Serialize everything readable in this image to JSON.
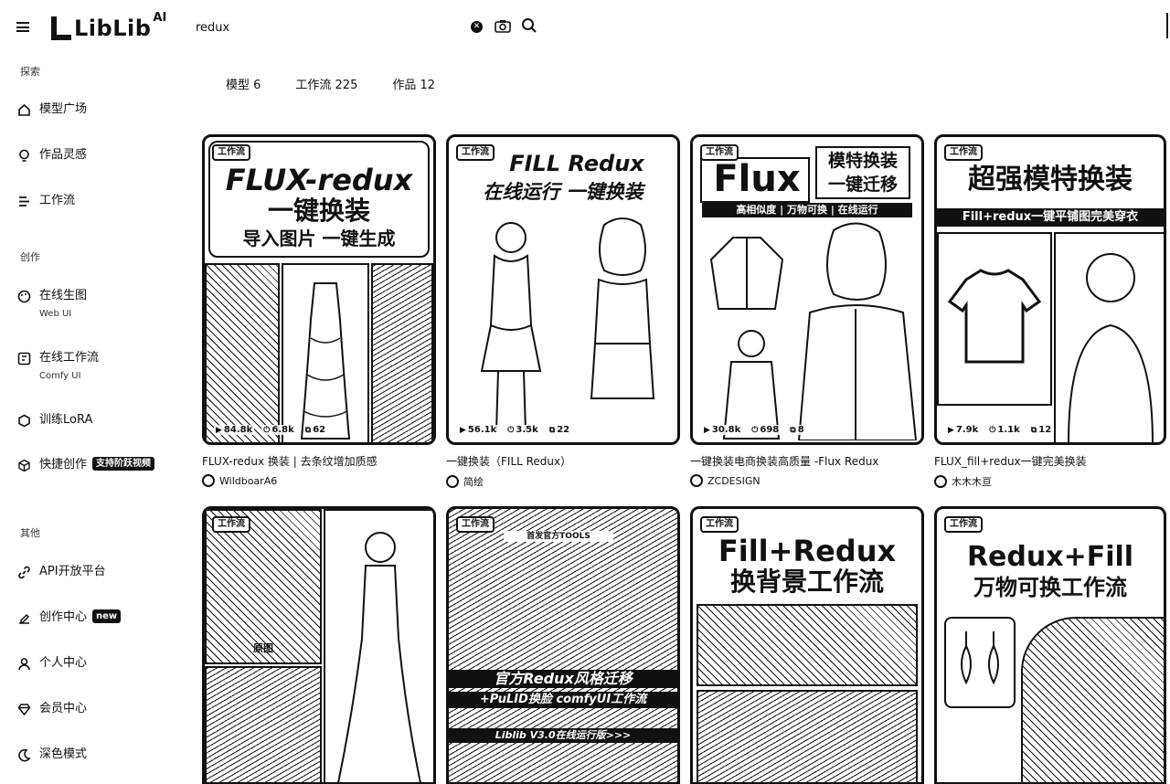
{
  "header": {
    "logo_text": "LibLib",
    "logo_ai": "AI",
    "search_value": "redux"
  },
  "sidebar": {
    "section_explore": "探索",
    "section_create": "创作",
    "section_other": "其他",
    "items": [
      {
        "label": "模型广场",
        "icon": "home-icon"
      },
      {
        "label": "作品灵感",
        "icon": "bulb-icon"
      },
      {
        "label": "工作流",
        "icon": "workflow-icon"
      },
      {
        "label": "在线生图",
        "sub": "Web UI",
        "icon": "palette-icon"
      },
      {
        "label": "在线工作流",
        "sub": "Comfy UI",
        "icon": "comfy-icon"
      },
      {
        "label": "训练LoRA",
        "icon": "cube-icon"
      },
      {
        "label": "快捷创作",
        "badge": "支持阶跃视频",
        "icon": "box-icon"
      },
      {
        "label": "API开放平台",
        "icon": "link-icon"
      },
      {
        "label": "创作中心",
        "badge": "new",
        "icon": "edit-icon"
      },
      {
        "label": "个人中心",
        "icon": "user-icon"
      },
      {
        "label": "会员中心",
        "icon": "diamond-icon"
      },
      {
        "label": "深色模式",
        "icon": "moon-icon"
      }
    ]
  },
  "tabs": [
    {
      "label": "模型 6"
    },
    {
      "label": "工作流 225"
    },
    {
      "label": "作品 12"
    }
  ],
  "cards": [
    {
      "tag": "工作流",
      "headline": [
        "FLUX-redux",
        "一键换装",
        "导入图片 一键生成"
      ],
      "stats": {
        "views": "84.8k",
        "runs": "6.8k",
        "saves": "62"
      },
      "title": "FLUX-redux 换装 | 去条纹增加质感",
      "author": "WildboarA6"
    },
    {
      "tag": "工作流",
      "headline": [
        "FILL Redux",
        "在线运行 一键换装"
      ],
      "stats": {
        "views": "56.1k",
        "runs": "3.5k",
        "saves": "22"
      },
      "title": "一键换装（FILL Redux）",
      "author": "简绘"
    },
    {
      "tag": "工作流",
      "headline": [
        "Flux",
        "模特换装",
        "一键迁移",
        "高相似度 | 万物可换 | 在线运行"
      ],
      "stats": {
        "views": "30.8k",
        "runs": "698",
        "saves": "8"
      },
      "title": "一键换装电商换装高质量 -Flux Redux",
      "author": "ZCDESIGN"
    },
    {
      "tag": "工作流",
      "headline": [
        "超强模特换装",
        "Fill+redux一键平铺图完美穿衣"
      ],
      "stats": {
        "views": "7.9k",
        "runs": "1.1k",
        "saves": "12"
      },
      "title": "FLUX_fill+redux一键完美换装",
      "author": "木木木亘"
    },
    {
      "tag": "工作流",
      "headline": [
        "原图"
      ],
      "title": "",
      "author": ""
    },
    {
      "tag": "工作流",
      "headline": [
        "首发官方TOOLS",
        "官方Redux风格迁移",
        "+PuLID换脸 comfyUI工作流",
        "Liblib V3.0在线运行版>>>"
      ],
      "title": "",
      "author": ""
    },
    {
      "tag": "工作流",
      "headline": [
        "Fill+Redux",
        "换背景工作流"
      ],
      "title": "",
      "author": ""
    },
    {
      "tag": "工作流",
      "headline": [
        "Redux+Fill",
        "万物可换工作流"
      ],
      "title": "",
      "author": ""
    }
  ]
}
